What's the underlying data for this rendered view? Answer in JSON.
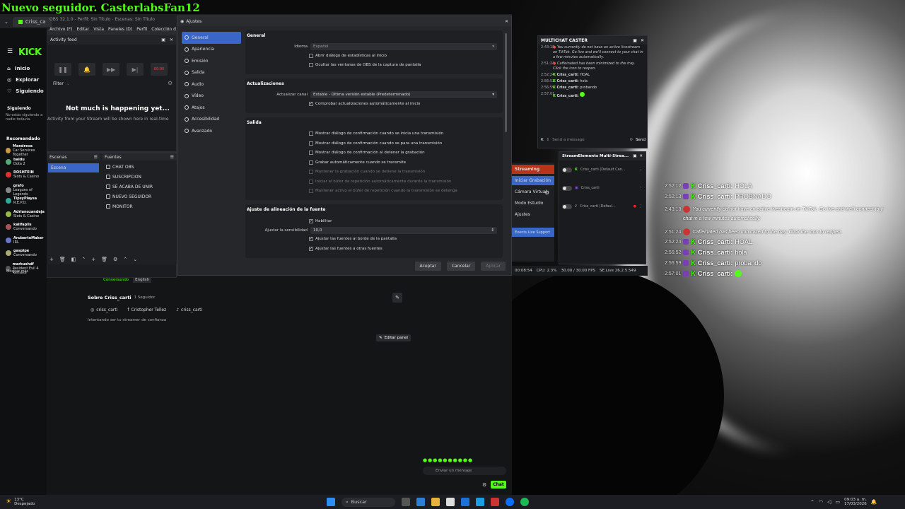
{
  "banner": "Nuevo seguidor. CasterlabsFan12",
  "browser": {
    "tab_label": "Criss_ca",
    "url_prefix": "https"
  },
  "kick": {
    "logo": "KICK",
    "nav": [
      "Inicio",
      "Explorar",
      "Siguiendo"
    ],
    "siguiendo_title": "Siguiendo",
    "siguiendo_text": "No estás siguiendo a nadie todavía.",
    "recomendado_title": "Recomendado",
    "recommended": [
      {
        "name": "Mandreva",
        "sub": "Car Services Together"
      },
      {
        "name": "baldu",
        "sub": "Dota 2"
      },
      {
        "name": "ROSHTEIN",
        "sub": "Slots & Casino"
      },
      {
        "name": "grafo",
        "sub": "Leagues of Legends"
      },
      {
        "name": "TipsyPlaysa",
        "sub": "R.E.P.O."
      },
      {
        "name": "Adrianozandeja",
        "sub": "Slots & Casino"
      },
      {
        "name": "kaiifaplis",
        "sub": "Conversando"
      },
      {
        "name": "ArubertoMaker",
        "sub": "IRL"
      },
      {
        "name": "gaspipe",
        "sub": "Conversando"
      },
      {
        "name": "markushdf",
        "sub": "Resident Evil 4 Remake"
      }
    ],
    "mostrar_mas": "Mostrar más"
  },
  "activity": {
    "title": "Activity feed",
    "filter": "Filter",
    "empty_title": "Not much is happening yet...",
    "empty_text": "Activity from your Stream will be shown here in real-time",
    "time_badge": "00:00"
  },
  "obs": {
    "title": "OBS 32.1.0 - Perfil: Sin Título - Escenas: Sin Título",
    "menu": [
      "Archivo (F)",
      "Editar",
      "Vista",
      "Paneles (D)",
      "Perfil",
      "Colección d"
    ],
    "scenes_header": "Escenas",
    "sources_header": "Fuentes",
    "scene_item": "Escena",
    "sources": [
      "CHAT OBS",
      "SUSCRIPCION",
      "SE ACABA DE UNIR",
      "NUEVO SEGUIDOR",
      "MONITOR"
    ]
  },
  "settings": {
    "title": "Ajustes",
    "nav": [
      "General",
      "Apariencia",
      "Emisión",
      "Salida",
      "Audio",
      "Vídeo",
      "Atajos",
      "Accesibilidad",
      "Avanzado"
    ],
    "general": {
      "heading": "General",
      "idioma_label": "Idioma",
      "idioma_value": "Español",
      "checks": [
        "Abrir diálogo de estadísticas al inicio",
        "Ocultar las ventanas de OBS de la captura de pantalla"
      ]
    },
    "updates": {
      "heading": "Actualizaciones",
      "channel_label": "Actualizar canal",
      "channel_value": "Estable - Última versión estable (Predeterminado)",
      "check": "Comprobar actualizaciones automáticamente al inicio"
    },
    "output": {
      "heading": "Salida",
      "checks": [
        "Mostrar diálogo de confirmación cuando se inicia una transmisión",
        "Mostrar diálogo de confirmación cuando se para una transmisión",
        "Mostrar diálogo de confirmación al detener la grabación",
        "Grabar automáticamente cuando se transmite",
        "Mantener la grabación cuando se detiene la transmisión",
        "Iniciar el búfer de repetición automáticamente durante la transmisión",
        "Mantener activo el búfer de repetición cuando la transmisión se detenga"
      ]
    },
    "snap": {
      "heading": "Ajuste de alineación de la fuente",
      "enable": "Habilitar",
      "sens_label": "Ajustar la sensibilidad",
      "sens_value": "10,0",
      "checks": [
        "Ajustar las fuentes al borde de la pantalla",
        "Ajustar las fuentes a otras fuentes"
      ]
    },
    "buttons": {
      "ok": "Aceptar",
      "cancel": "Cancelar",
      "apply": "Aplicar"
    }
  },
  "profile": {
    "status": "Conversando",
    "lang": "English",
    "about": "Sobre Criss_carti",
    "followers": "1 Seguidor",
    "links": [
      "criss_carti",
      "Cristopher Tellez",
      "criss_carti"
    ],
    "bio": "Intentando ser tu streamer de confianza",
    "edit_panel": "Editar panel",
    "chat_placeholder": "Enviar un mensaje",
    "chat_button": "Chat"
  },
  "multichat": {
    "title": "MULTICHAT CASTER",
    "messages": [
      {
        "ts": "2:43:18",
        "text": "You currently do not have an active livestream on TikTok. Go live and we'll connect to your chat in a few minutes automatically."
      },
      {
        "ts": "2:51:24",
        "text": "Caffeinated has been minimized to the tray. Click the icon to reopen."
      },
      {
        "ts": "2:52:24",
        "name": "Criss_carti:",
        "text": "HOAL"
      },
      {
        "ts": "2:56:52",
        "name": "Criss_carti:",
        "text": "hola"
      },
      {
        "ts": "2:56:59",
        "name": "Criss_carti:",
        "text": "probando"
      },
      {
        "ts": "2:57:01",
        "name": "Criss_carti:",
        "text": ""
      }
    ],
    "send_placeholder": "Send a message",
    "send_label": "Send"
  },
  "streamelements": {
    "title": "StreamElements Multi-Strea...",
    "rows": [
      {
        "name": "Criss_carti (Default Can..."
      },
      {
        "name": "Criss_carti"
      },
      {
        "name": "Criss_carti (Defaul..."
      }
    ]
  },
  "controls": {
    "items": [
      "Streaming",
      "Iniciar Grabación",
      "Cámara Virtual",
      "Modo Estudio",
      "Ajustes"
    ],
    "support": "Events Live Support"
  },
  "status": {
    "time": "00:08:54",
    "cpu": "CPU: 2.3%",
    "fps": "30.00 / 30.00 FPS",
    "se": "SE.Live 26.2.5.549"
  },
  "overlay": [
    {
      "ts": "2:52:12",
      "name": "Criss_carti:",
      "text": "HOLA"
    },
    {
      "ts": "2:52:13",
      "name": "Criss_carti:",
      "text": "PROBNADO"
    },
    {
      "ts": "2:43:18",
      "name": "",
      "text": "You currently do not have an active livestream on TikTok. Go live and we'll connect to y",
      "text2": "chat in a few minutes automatically."
    },
    {
      "ts": "2:51:24",
      "name": "",
      "text": "Caffeinated has been minimized to the tray. Click the icon to reopen."
    },
    {
      "ts": "2:52:24",
      "name": "Criss_carti:",
      "text": "HOAL."
    },
    {
      "ts": "2:56:52",
      "name": "Criss_carti:",
      "text": "hola"
    },
    {
      "ts": "2:56:59",
      "name": "Criss_carti:",
      "text": "probando"
    },
    {
      "ts": "2:57:01",
      "name": "Criss_carti:",
      "text": ""
    }
  ],
  "taskbar": {
    "weather_temp": "13°C",
    "weather_text": "Despejado",
    "search": "Buscar",
    "clock_time": "09:03 a. m.",
    "clock_date": "17/03/2026"
  },
  "colors": {
    "kick_green": "#53fc18",
    "obs_blue": "#3a66c7",
    "stream_red": "#b7341a"
  }
}
